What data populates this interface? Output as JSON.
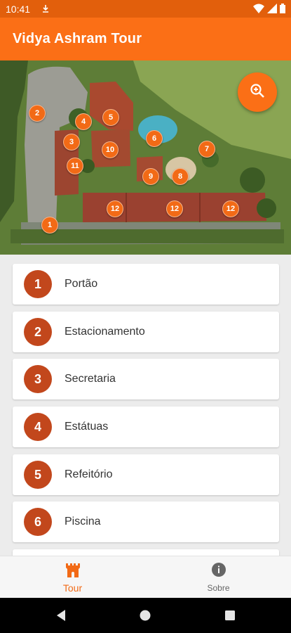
{
  "status_bar": {
    "time": "10:41",
    "icons": [
      "download-icon",
      "wifi-icon",
      "signal-icon",
      "battery-icon"
    ]
  },
  "app_bar": {
    "title": "Vidya Ashram Tour"
  },
  "map": {
    "pins": [
      "2",
      "5",
      "4",
      "3",
      "6",
      "10",
      "7",
      "11",
      "9",
      "8",
      "12",
      "12",
      "12",
      "1"
    ],
    "zoom_icon": "zoom-in-icon"
  },
  "locations": [
    {
      "number": "1",
      "name": "Portão"
    },
    {
      "number": "2",
      "name": "Estacionamento"
    },
    {
      "number": "3",
      "name": "Secretaria"
    },
    {
      "number": "4",
      "name": "Estátuas"
    },
    {
      "number": "5",
      "name": "Refeitório"
    },
    {
      "number": "6",
      "name": "Piscina"
    }
  ],
  "bottom_nav": {
    "tabs": [
      {
        "label": "Tour",
        "icon": "castle-icon",
        "active": true
      },
      {
        "label": "Sobre",
        "icon": "info-icon",
        "active": false
      }
    ]
  },
  "colors": {
    "primary": "#fb6f16",
    "status_bar": "#e25f0c",
    "number_badge": "#c2471c",
    "active_tab": "#f26a16"
  }
}
